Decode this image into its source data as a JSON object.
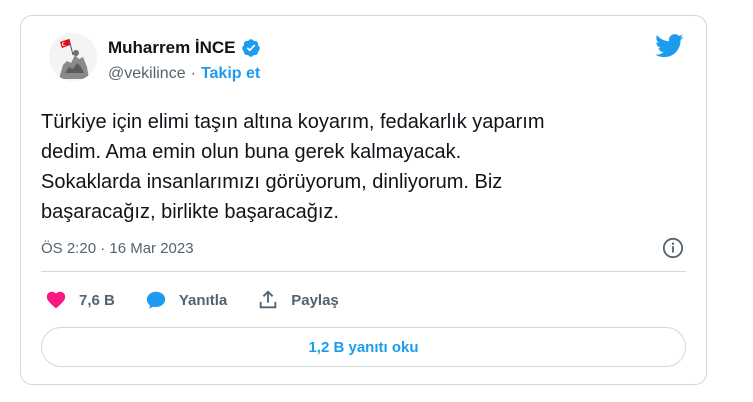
{
  "author": {
    "name": "Muharrem İNCE",
    "handle": "@vekilince",
    "separator": "·",
    "follow_label": "Takip et"
  },
  "tweet": {
    "text": "Türkiye için elimi taşın altına koyarım, fedakarlık yaparım\ndedim. Ama emin olun buna gerek kalmayacak.\nSokaklarda insanlarımızı görüyorum, dinliyorum. Biz\nbaşaracağız, birlikte başaracağız.",
    "timestamp": "ÖS 2:20 · 16 Mar 2023"
  },
  "actions": {
    "like_count": "7,6 B",
    "reply_label": "Yanıtla",
    "share_label": "Paylaş"
  },
  "replies_button_label": "1,2 B yanıtı oku",
  "colors": {
    "accent": "#1d9bf0",
    "like": "#f91880",
    "secondary_text": "#536471",
    "border": "#cfd9de"
  },
  "icons": [
    "verified-badge-icon",
    "twitter-bird-icon",
    "info-icon",
    "heart-icon",
    "reply-bubble-icon",
    "share-icon"
  ]
}
